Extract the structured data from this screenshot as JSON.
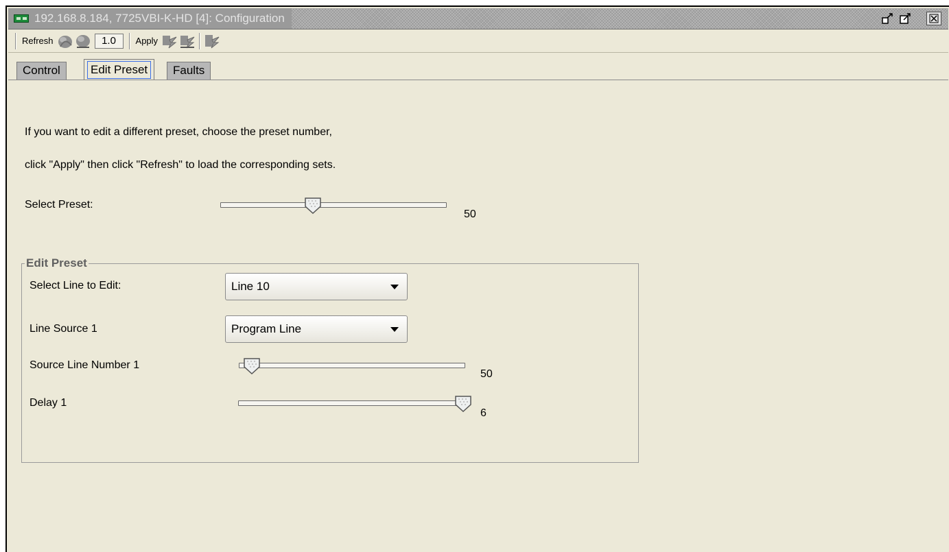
{
  "window": {
    "title": "192.168.8.184, 7725VBI-K-HD  [4]: Configuration"
  },
  "titlebar_buttons": {
    "detach": "detach-icon",
    "maximize": "maximize-icon",
    "close": "close-icon"
  },
  "toolbar": {
    "refresh_label": "Refresh",
    "version_value": "1.0",
    "apply_label": "Apply"
  },
  "tabs": [
    {
      "label": "Control",
      "active": false
    },
    {
      "label": "Edit Preset",
      "active": true
    },
    {
      "label": "Faults",
      "active": false
    }
  ],
  "main": {
    "instruction_line1": "If you want to edit a different preset, choose the preset number,",
    "instruction_line2": "click \"Apply\" then click \"Refresh\" to load the corresponding sets.",
    "select_preset": {
      "label": "Select Preset:",
      "value": "50",
      "position_fraction": 0.4
    }
  },
  "edit_preset_group": {
    "legend": "Edit Preset",
    "select_line": {
      "label": "Select Line to Edit:",
      "selected": "Line 10"
    },
    "line_source": {
      "label": "Line Source 1",
      "selected": "Program Line"
    },
    "source_line_number": {
      "label": "Source Line Number 1",
      "value": "50",
      "position_fraction": 0.02
    },
    "delay": {
      "label": "Delay 1",
      "value": "6",
      "position_fraction": 1.0
    }
  },
  "colors": {
    "background": "#ECE9D8",
    "titlebar": "#9A9A9A",
    "title_text": "#E4E4E4",
    "tab_inactive": "#B7B7B7",
    "focus_outline": "#3A6EE8",
    "group_legend": "#606060"
  }
}
